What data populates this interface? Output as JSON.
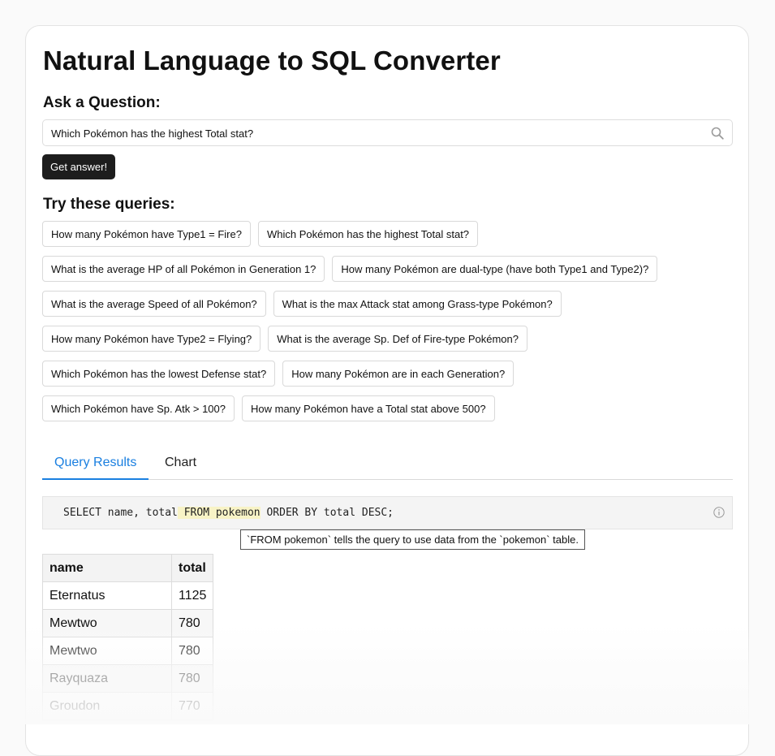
{
  "page": {
    "title": "Natural Language to SQL Converter",
    "ask_heading": "Ask a Question:",
    "try_heading": "Try these queries:"
  },
  "search": {
    "value": "Which Pokémon has the highest Total stat?",
    "icon": "search-icon"
  },
  "submit_label": "Get answer!",
  "examples": [
    [
      "How many Pokémon have Type1 = Fire?",
      "Which Pokémon has the highest Total stat?"
    ],
    [
      "What is the average HP of all Pokémon in Generation 1?",
      "How many Pokémon are dual-type (have both Type1 and Type2)?"
    ],
    [
      "What is the average Speed of all Pokémon?",
      "What is the max Attack stat among Grass-type Pokémon?"
    ],
    [
      "How many Pokémon have Type2 = Flying?",
      "What is the average Sp. Def of Fire-type Pokémon?"
    ],
    [
      "Which Pokémon has the lowest Defense stat?",
      "How many Pokémon are in each Generation?"
    ],
    [
      "Which Pokémon have Sp. Atk > 100?",
      "How many Pokémon have a Total stat above 500?"
    ]
  ],
  "tabs": [
    {
      "label": "Query Results",
      "active": true
    },
    {
      "label": "Chart",
      "active": false
    }
  ],
  "sql": {
    "before": "SELECT name, total",
    "highlight": " FROM pokemon",
    "after": " ORDER BY total DESC;",
    "info_icon": "info-icon",
    "tooltip": "`FROM pokemon` tells the query to use data from the `pokemon` table."
  },
  "results": {
    "columns": [
      "name",
      "total"
    ],
    "rows": [
      [
        "Eternatus",
        "1125"
      ],
      [
        "Mewtwo",
        "780"
      ],
      [
        "Mewtwo",
        "780"
      ],
      [
        "Rayquaza",
        "780"
      ],
      [
        "Groudon",
        "770"
      ]
    ]
  },
  "colors": {
    "accent": "#1a7fe0",
    "button_bg": "#1d1d1d",
    "highlight": "#f8f3c6"
  }
}
